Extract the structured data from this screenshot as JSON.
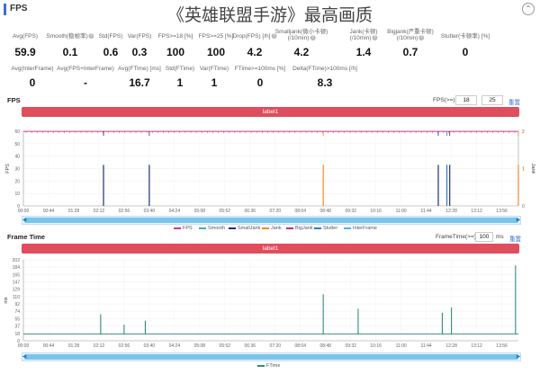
{
  "header": {
    "title": "FPS",
    "banner": "《英雄联盟手游》最高画质",
    "collapse_icon": "chevron-up-icon"
  },
  "stats_row1": [
    {
      "label": "Avg(FPS)",
      "value": "59.9",
      "help": false
    },
    {
      "label": "Smooth(稳帧率)",
      "value": "0.1",
      "help": true
    },
    {
      "label": "Std(FPS)",
      "value": "0.6",
      "help": false
    },
    {
      "label": "Var(FPS)",
      "value": "0.3",
      "help": false
    },
    {
      "label": "FPS>=18 [%]",
      "value": "100",
      "help": false
    },
    {
      "label": "FPS>=25 [%]",
      "value": "100",
      "help": false
    },
    {
      "label": "Drop(FPS) [/h]",
      "value": "4.2",
      "help": true
    },
    {
      "label": "Smalljank(微小卡顿)\n(/10min)",
      "value": "4.2",
      "help": true
    },
    {
      "label": "Jank(卡顿)\n(/10min)",
      "value": "1.4",
      "help": true
    },
    {
      "label": "Bigjank(严重卡顿)\n(/10min)",
      "value": "0.7",
      "help": true
    },
    {
      "label": "Stutter(卡顿率) [%]",
      "value": "0",
      "help": false
    }
  ],
  "stats_row2": [
    {
      "label": "Avg(InterFrame)",
      "value": "0"
    },
    {
      "label": "Avg(FPS+InterFrame)",
      "value": "-"
    },
    {
      "label": "Avg(FTime) [ms]",
      "value": "16.7"
    },
    {
      "label": "Std(FTime)",
      "value": "1"
    },
    {
      "label": "Var(FTime)",
      "value": "1"
    },
    {
      "label": "FTime>=100ms [%]",
      "value": "0"
    },
    {
      "label": "Delta(FTime)>100ms [/h]",
      "value": "8.3"
    }
  ],
  "fps_section": {
    "title": "FPS",
    "control_label": "FPS(>=)",
    "input1": "18",
    "input2": "25",
    "reset_label": "重置",
    "band_label": "label1",
    "y_axis_title": "FPS",
    "right_axis_title": "Jank",
    "legend": [
      {
        "name": "FPS",
        "color": "#d6338b"
      },
      {
        "name": "Smooth",
        "color": "#3fb2a4"
      },
      {
        "name": "SmallJank",
        "color": "#1f2d7a"
      },
      {
        "name": "Jank",
        "color": "#f08a24"
      },
      {
        "name": "BigJank",
        "color": "#c0306a"
      },
      {
        "name": "Stutter",
        "color": "#2f77c9"
      },
      {
        "name": "InterFrame",
        "color": "#4fb3e8"
      }
    ]
  },
  "ftime_section": {
    "title": "Frame Time",
    "control_label": "FrameTime(>=)",
    "input1": "100",
    "unit": "ms",
    "reset_label": "重置",
    "band_label": "label1",
    "y_axis_title": "ms",
    "legend": [
      {
        "name": "FTime",
        "color": "#2e8b7a"
      }
    ]
  },
  "x_ticks": [
    "00:00",
    "00:44",
    "01:28",
    "02:12",
    "02:56",
    "03:40",
    "04:24",
    "05:08",
    "05:52",
    "06:36",
    "07:20",
    "08:04",
    "08:48",
    "09:32",
    "10:16",
    "11:00",
    "11:44",
    "12:28",
    "13:12",
    "13:56"
  ],
  "chart_data": [
    {
      "type": "line",
      "title": "FPS",
      "ylabel": "FPS",
      "ylim": [
        0,
        60
      ],
      "y_ticks": [
        0,
        10,
        20,
        30,
        40,
        50,
        60
      ],
      "y2_ticks": [
        0,
        1,
        2
      ],
      "y2label": "Jank",
      "xlim": [
        "00:00",
        "14:25"
      ],
      "series": [
        {
          "name": "FPS",
          "color": "#d6338b",
          "value_approx": 59.9
        },
        {
          "name": "SmallJank",
          "color": "#1f2d7a",
          "spikes": [
            {
              "x": "02:20",
              "y": 33
            },
            {
              "x": "03:40",
              "y": 33
            },
            {
              "x": "12:05",
              "y": 33
            },
            {
              "x": "12:25",
              "y": 33
            }
          ]
        },
        {
          "name": "Jank",
          "color": "#f08a24",
          "spikes": [
            {
              "x": "08:44",
              "y": 33
            },
            {
              "x": "14:25",
              "y": 33
            }
          ]
        },
        {
          "name": "Stutter",
          "color": "#2f77c9",
          "spikes": [
            {
              "x": "12:20",
              "y": 33
            }
          ]
        }
      ],
      "x_axis_labels_on": true,
      "grid": true
    },
    {
      "type": "line",
      "title": "Frame Time",
      "ylabel": "ms",
      "ylim": [
        0,
        202
      ],
      "y_ticks": [
        0,
        18,
        37,
        55,
        74,
        92,
        110,
        129,
        147,
        165,
        184,
        202
      ],
      "xlim": [
        "00:00",
        "14:25"
      ],
      "series": [
        {
          "name": "FTime",
          "color": "#2e8b7a",
          "baseline": 16.7,
          "spikes": [
            {
              "x": "02:15",
              "y": 66
            },
            {
              "x": "02:56",
              "y": 40
            },
            {
              "x": "03:33",
              "y": 50
            },
            {
              "x": "08:44",
              "y": 116
            },
            {
              "x": "09:45",
              "y": 80
            },
            {
              "x": "12:12",
              "y": 70
            },
            {
              "x": "12:28",
              "y": 83
            },
            {
              "x": "14:20",
              "y": 188
            }
          ]
        }
      ],
      "grid": true
    }
  ]
}
